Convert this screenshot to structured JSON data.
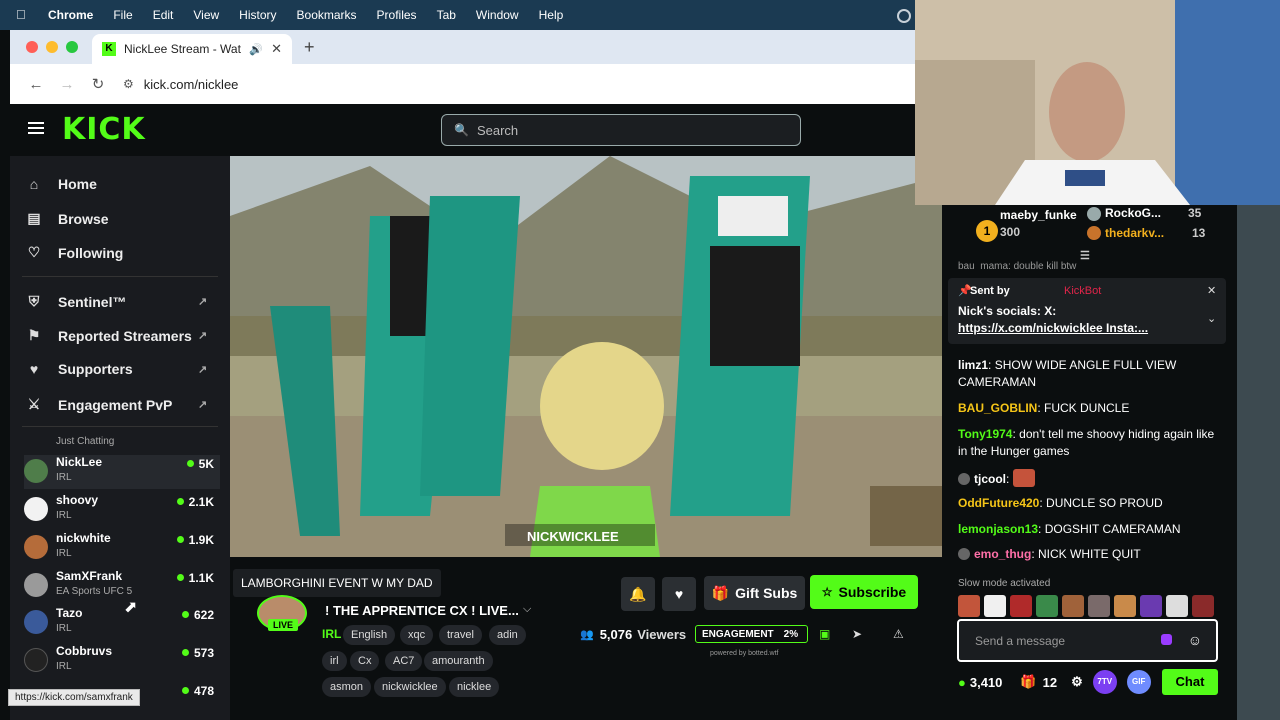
{
  "menubar": {
    "app": "Chrome",
    "items": [
      "File",
      "Edit",
      "View",
      "History",
      "Bookmarks",
      "Profiles",
      "Tab",
      "Window",
      "Help"
    ]
  },
  "browser": {
    "tab_title": "NickLee Stream - Watch",
    "url": "kick.com/nicklee",
    "status_url": "https://kick.com/samxfrank"
  },
  "kick": {
    "logo": "KICK",
    "search_placeholder": "Search"
  },
  "sidebar": {
    "nav": [
      {
        "label": "Home",
        "icon": "home-icon"
      },
      {
        "label": "Browse",
        "icon": "browse-icon"
      },
      {
        "label": "Following",
        "icon": "heart-icon"
      }
    ],
    "mod": [
      {
        "label": "Sentinel™",
        "icon": "shield-icon"
      },
      {
        "label": "Reported Streamers",
        "icon": "flag-icon"
      },
      {
        "label": "Supporters",
        "icon": "heart-icon"
      },
      {
        "label": "Engagement PvP",
        "icon": "swords-icon"
      }
    ],
    "partial_category": "Just Chatting",
    "channels": [
      {
        "name": "NickLee",
        "category": "IRL",
        "viewers": "5K",
        "avatar_color": "#4f7d4a"
      },
      {
        "name": "shoovy",
        "category": "IRL",
        "viewers": "2.1K",
        "avatar_color": "#f2f2f2"
      },
      {
        "name": "nickwhite",
        "category": "IRL",
        "viewers": "1.9K",
        "avatar_color": "#b56c3a"
      },
      {
        "name": "SamXFrank",
        "category": "EA Sports UFC 5",
        "viewers": "1.1K",
        "avatar_color": "#9a9a9a"
      },
      {
        "name": "Tazo",
        "category": "IRL",
        "viewers": "622",
        "avatar_color": "#3a5a9a"
      },
      {
        "name": "Cobbruvs",
        "category": "IRL",
        "viewers": "573",
        "avatar_color": "#222222"
      },
      {
        "name": "",
        "category": "",
        "viewers": "478",
        "avatar_color": "#444444"
      }
    ]
  },
  "video": {
    "caption": "NICKWICKLEE"
  },
  "stream": {
    "tooltip": "LAMBORGHINI EVENT W MY DAD",
    "live_label": "LIVE",
    "title": "! THE APPRENTICE CX ! LIVE...",
    "category": "IRL",
    "tags": [
      "English",
      "xqc",
      "travel",
      "adin",
      "irl",
      "Cx",
      "AC7",
      "amouranth",
      "asmon",
      "nickwicklee",
      "nicklee"
    ],
    "gift_label": "Gift Subs",
    "subscribe_label": "Subscribe",
    "viewers_count": "5,076",
    "viewers_label": "Viewers",
    "engagement_label": "ENGAGEMENT",
    "engagement_value": "2%",
    "powered_by": "powered by botted.wtf"
  },
  "chat": {
    "leaderboard": [
      {
        "rank": "1",
        "name": "maeby_funke",
        "value": "300"
      },
      {
        "rank": "",
        "name": "RockoG...",
        "value": "35"
      },
      {
        "rank": "",
        "name": "thedarkv...",
        "value": "13"
      }
    ],
    "partial_top": "bau_mama: double kill btw",
    "pinned": {
      "sent_by": "Sent by",
      "sender": "KickBot",
      "text": "Nick's socials: X:",
      "link": "https://x.com/nickwicklee Insta:..."
    },
    "messages": [
      {
        "user": "limz1",
        "color": "#ffffff",
        "text": "SHOW WIDE ANGLE FULL VIEW CAMERAMAN"
      },
      {
        "user": "BAU_GOBLIN",
        "color": "#f5c518",
        "text": "FUCK DUNCLE"
      },
      {
        "user": "Tony1974",
        "color": "#53fc18",
        "text": "don't tell me shoovy hiding again like in the Hunger games"
      },
      {
        "user": "tjcool",
        "color": "#ffffff",
        "text": ""
      },
      {
        "user": "OddFuture420",
        "color": "#f5c518",
        "text": "DUNCLE SO PROUD"
      },
      {
        "user": "lemonjason13",
        "color": "#53fc18",
        "text": "DOGSHIT CAMERAMAN"
      },
      {
        "user": "emo_thug",
        "color": "#ff6fa8",
        "text": "NICK WHITE QUIT"
      }
    ],
    "slow_mode": "Slow mode activated",
    "input_placeholder": "Send a message",
    "points": "3,410",
    "gift_count": "12",
    "badges": [
      "7TV",
      "GIF"
    ],
    "chat_button": "Chat"
  }
}
